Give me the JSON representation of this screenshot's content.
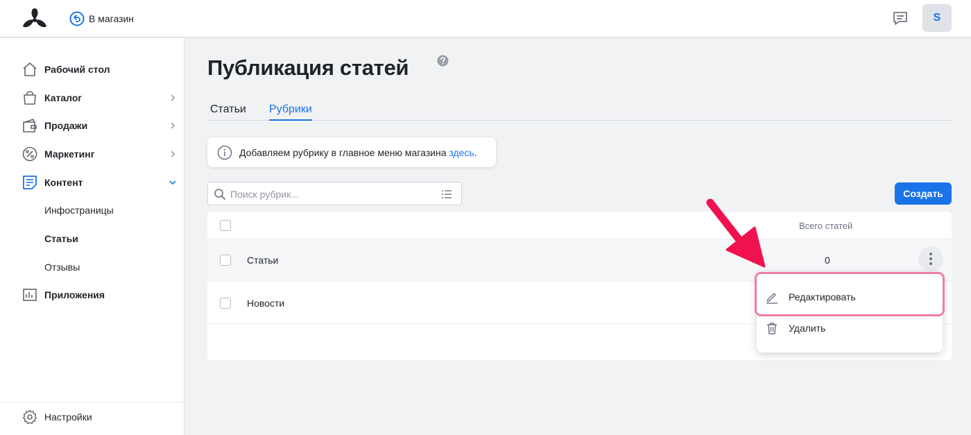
{
  "header": {
    "back_label": "В магазин",
    "avatar_letter": "S"
  },
  "sidebar": {
    "items": [
      {
        "label": "Рабочий стол",
        "icon": "home-icon"
      },
      {
        "label": "Каталог",
        "icon": "bag-icon"
      },
      {
        "label": "Продажи",
        "icon": "wallet-icon"
      },
      {
        "label": "Маркетинг",
        "icon": "percent-icon"
      },
      {
        "label": "Контент",
        "icon": "document-icon"
      },
      {
        "label": "Приложения",
        "icon": "apps-icon"
      }
    ],
    "subitems": [
      {
        "label": "Инфостраницы"
      },
      {
        "label": "Статьи"
      },
      {
        "label": "Отзывы"
      }
    ],
    "settings_label": "Настройки"
  },
  "main": {
    "title": "Публикация статей",
    "tabs": [
      {
        "label": "Статьи"
      },
      {
        "label": "Рубрики"
      }
    ],
    "info": {
      "text": "Добавляем рубрику в главное меню магазина ",
      "link": "здесь",
      "suffix": "."
    },
    "search_placeholder": "Поиск рубрик...",
    "create_label": "Создать",
    "table": {
      "count_header": "Всего статей",
      "rows": [
        {
          "name": "Статьи",
          "count": "0"
        },
        {
          "name": "Новости",
          "count": ""
        }
      ]
    },
    "menu": {
      "edit_label": "Редактировать",
      "delete_label": "Удалить"
    }
  },
  "colors": {
    "accent": "#1a73e8",
    "annotation": "#f0124f",
    "highlight": "#ef7ea0"
  }
}
